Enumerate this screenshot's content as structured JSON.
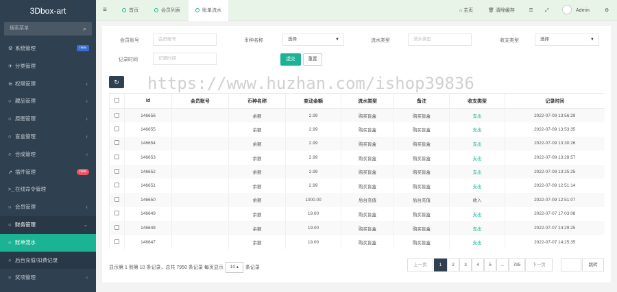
{
  "app": {
    "logo": "3Dbox-art",
    "search_placeholder": "搜索菜单"
  },
  "sidebar": {
    "items": [
      {
        "label": "系统管理",
        "icon": "gears-icon",
        "badge": "new"
      },
      {
        "label": "分类管理",
        "icon": "send-icon"
      },
      {
        "label": "权限管理",
        "icon": "layers-icon",
        "arrow": "‹"
      },
      {
        "label": "藏品管理",
        "icon": "circle-icon",
        "arrow": "‹"
      },
      {
        "label": "原图管理",
        "icon": "circle-icon",
        "arrow": "‹"
      },
      {
        "label": "盲盒管理",
        "icon": "circle-icon",
        "arrow": "‹"
      },
      {
        "label": "合成管理",
        "icon": "circle-icon",
        "arrow": "‹"
      },
      {
        "label": "插件管理",
        "icon": "rocket-icon",
        "badge": "new"
      },
      {
        "label": "在线命令管理",
        "icon": "terminal-icon"
      },
      {
        "label": "会员管理",
        "icon": "circle-icon",
        "arrow": "‹"
      },
      {
        "label": "财务管理",
        "icon": "circle-icon",
        "arrow": "⌄"
      },
      {
        "label": "账单流水",
        "icon": "circle-icon"
      },
      {
        "label": "后台充值/扣费记录",
        "icon": "circle-icon"
      },
      {
        "label": "奖项管理",
        "icon": "circle-icon",
        "arrow": "‹"
      }
    ]
  },
  "topbar": {
    "tabs": [
      "首页",
      "会员列表",
      "账单流水"
    ],
    "home": "主页",
    "clear_cache": "清除缓存",
    "user": "Admin"
  },
  "filters": {
    "member_account_label": "会员账号",
    "member_account_placeholder": "会员账号",
    "coin_label": "币种名称",
    "coin_value": "选择",
    "flow_type_label": "流水类型",
    "flow_type_placeholder": "流水类型",
    "inout_label": "收支类型",
    "inout_value": "选择",
    "time_label": "记录时间",
    "time_placeholder": "记录时间",
    "submit": "提交",
    "reset": "重置"
  },
  "table": {
    "headers": [
      "Id",
      "会员账号",
      "币种名称",
      "变动金额",
      "流水类型",
      "备注",
      "收支类型",
      "记录时间"
    ],
    "rows": [
      [
        "146656",
        "",
        "余额",
        "2.99",
        "购买盲盒",
        "购买盲盒",
        "支出",
        "2022-07-09 13:56:29"
      ],
      [
        "146655",
        "",
        "余额",
        "2.99",
        "购买盲盒",
        "购买盲盒",
        "支出",
        "2022-07-09 13:53:35"
      ],
      [
        "146654",
        "",
        "余额",
        "2.99",
        "购买盲盒",
        "购买盲盒",
        "支出",
        "2022-07-09 13:30:26"
      ],
      [
        "146653",
        "",
        "余额",
        "2.99",
        "购买盲盒",
        "购买盲盒",
        "支出",
        "2022-07-09 13:28:57"
      ],
      [
        "146652",
        "",
        "余额",
        "2.99",
        "购买盲盒",
        "购买盲盒",
        "支出",
        "2022-07-09 13:25:25"
      ],
      [
        "146651",
        "",
        "余额",
        "2.99",
        "购买盲盒",
        "购买盲盒",
        "支出",
        "2022-07-09 12:51:14"
      ],
      [
        "146650",
        "",
        "余额",
        "1000.00",
        "后台充值",
        "后台充值",
        "收入",
        "2022-07-09 12:51:07"
      ],
      [
        "146649",
        "",
        "余额",
        "19.00",
        "购买盲盒",
        "购买盲盒",
        "支出",
        "2022-07-07 17:03:08"
      ],
      [
        "146648",
        "",
        "余额",
        "19.00",
        "购买盲盒",
        "购买盲盒",
        "支出",
        "2022-07-07 14:29:25"
      ],
      [
        "146647",
        "",
        "余额",
        "19.00",
        "购买盲盒",
        "购买盲盒",
        "支出",
        "2022-07-07 14:25:35"
      ]
    ]
  },
  "footer": {
    "info_prefix": "显示第 1 到第 10 条记录，总共 7950 条记录 每页显示",
    "page_size": "10",
    "info_suffix": "条记录",
    "prev": "上一页",
    "pages": [
      "1",
      "2",
      "3",
      "4",
      "5",
      "...",
      "795"
    ],
    "next": "下一页",
    "jump": "跳转"
  },
  "watermark": "https://www.huzhan.com/ishop39836",
  "colors": {
    "sidebar": "#2f4050",
    "accent": "#1ab394",
    "topbar": "#e8f4e8"
  }
}
